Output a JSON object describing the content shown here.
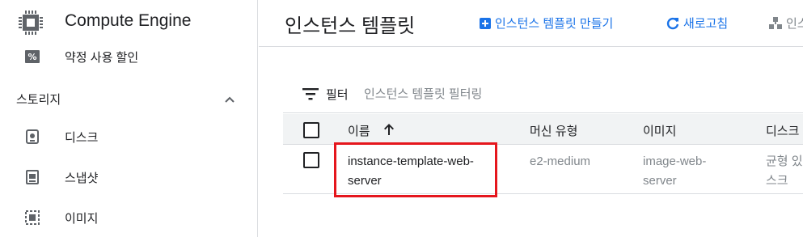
{
  "sidebar": {
    "product_title": "Compute Engine",
    "items_top": [
      {
        "label": "약정 사용 할인",
        "icon": "percent-icon"
      }
    ],
    "section": {
      "label": "스토리지",
      "icon": "chevron-up-icon"
    },
    "items": [
      {
        "label": "디스크",
        "icon": "disk-icon"
      },
      {
        "label": "스냅샷",
        "icon": "snapshot-icon"
      },
      {
        "label": "이미지",
        "icon": "image-icon"
      }
    ]
  },
  "header": {
    "title": "인스턴스 템플릿",
    "create_label": "인스턴스 템플릿 만들기",
    "refresh_label": "새로고침",
    "more_label": "인스"
  },
  "filter": {
    "label": "필터",
    "placeholder": "인스턴스 템플릿 필터링"
  },
  "table": {
    "columns": [
      "이름",
      "머신 유형",
      "이미지",
      "디스크"
    ],
    "rows": [
      {
        "name_line1": "instance-template-web-",
        "name_line2": "server",
        "machine_type": "e2-medium",
        "image_line1": "image-web-",
        "image_line2": "server",
        "disk_line1": "균형 있",
        "disk_line2": "스크"
      }
    ]
  },
  "colors": {
    "link_blue": "#1a73e8",
    "highlight_red": "#e5161d",
    "header_bg": "#f1f3f4",
    "muted_text": "#80868b"
  }
}
